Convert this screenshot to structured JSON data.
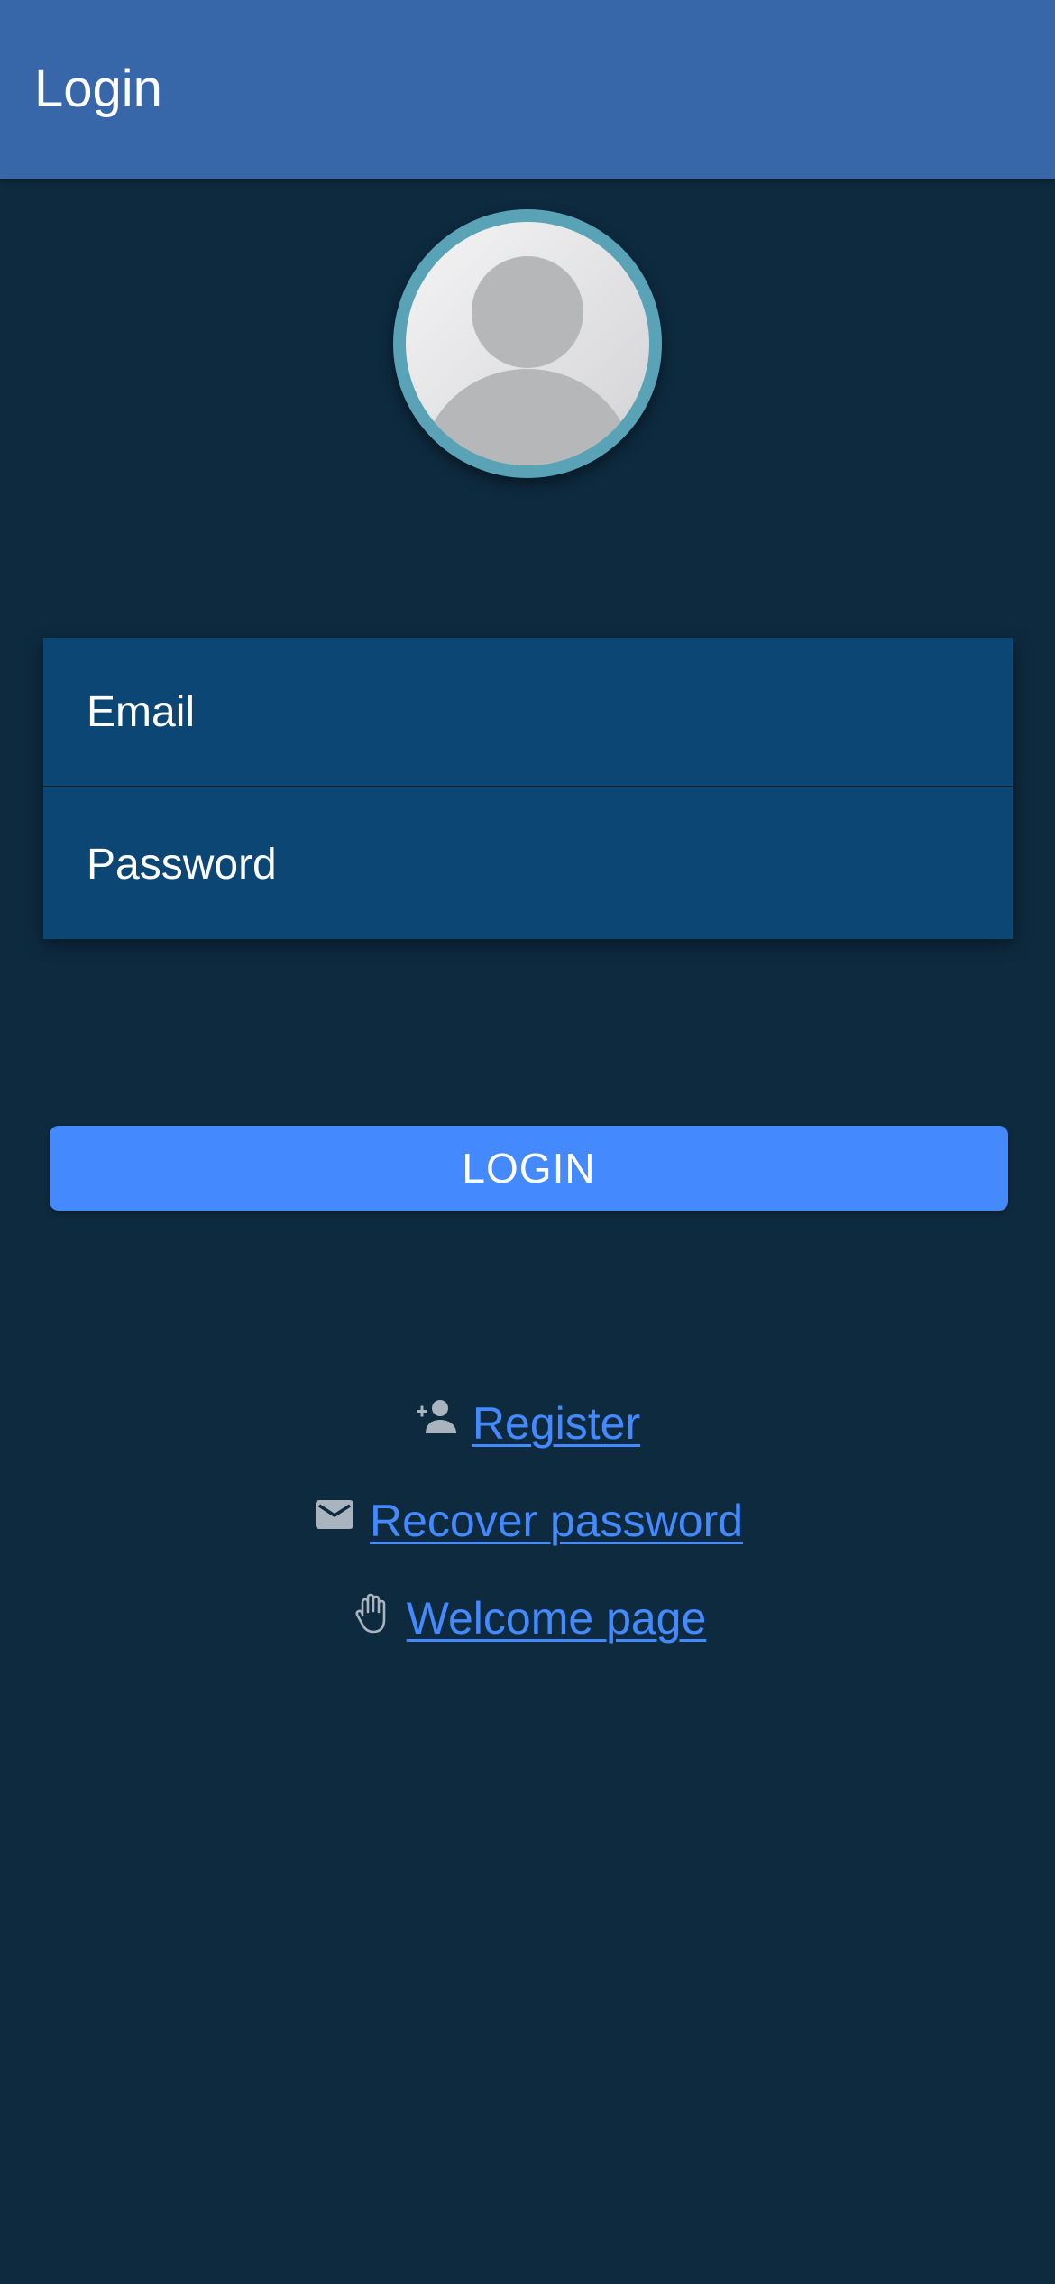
{
  "header": {
    "title": "Login"
  },
  "avatar": {
    "icon": "user-avatar-icon",
    "ring_color": "#5aa3b7"
  },
  "form": {
    "email": {
      "placeholder": "Email",
      "value": ""
    },
    "password": {
      "placeholder": "Password",
      "value": ""
    }
  },
  "login_button": {
    "label": "LOGIN",
    "color": "#4489fe"
  },
  "links": {
    "register": {
      "label": " Register",
      "icon": "person-add-icon"
    },
    "recover": {
      "label": " Recover password",
      "icon": "mail-icon"
    },
    "welcome": {
      "label": " Welcome page",
      "icon": "hand-icon"
    }
  },
  "colors": {
    "background": "#0e2a3f",
    "header": "#3766a9",
    "form": "#0c4674",
    "link": "#4489fe"
  }
}
